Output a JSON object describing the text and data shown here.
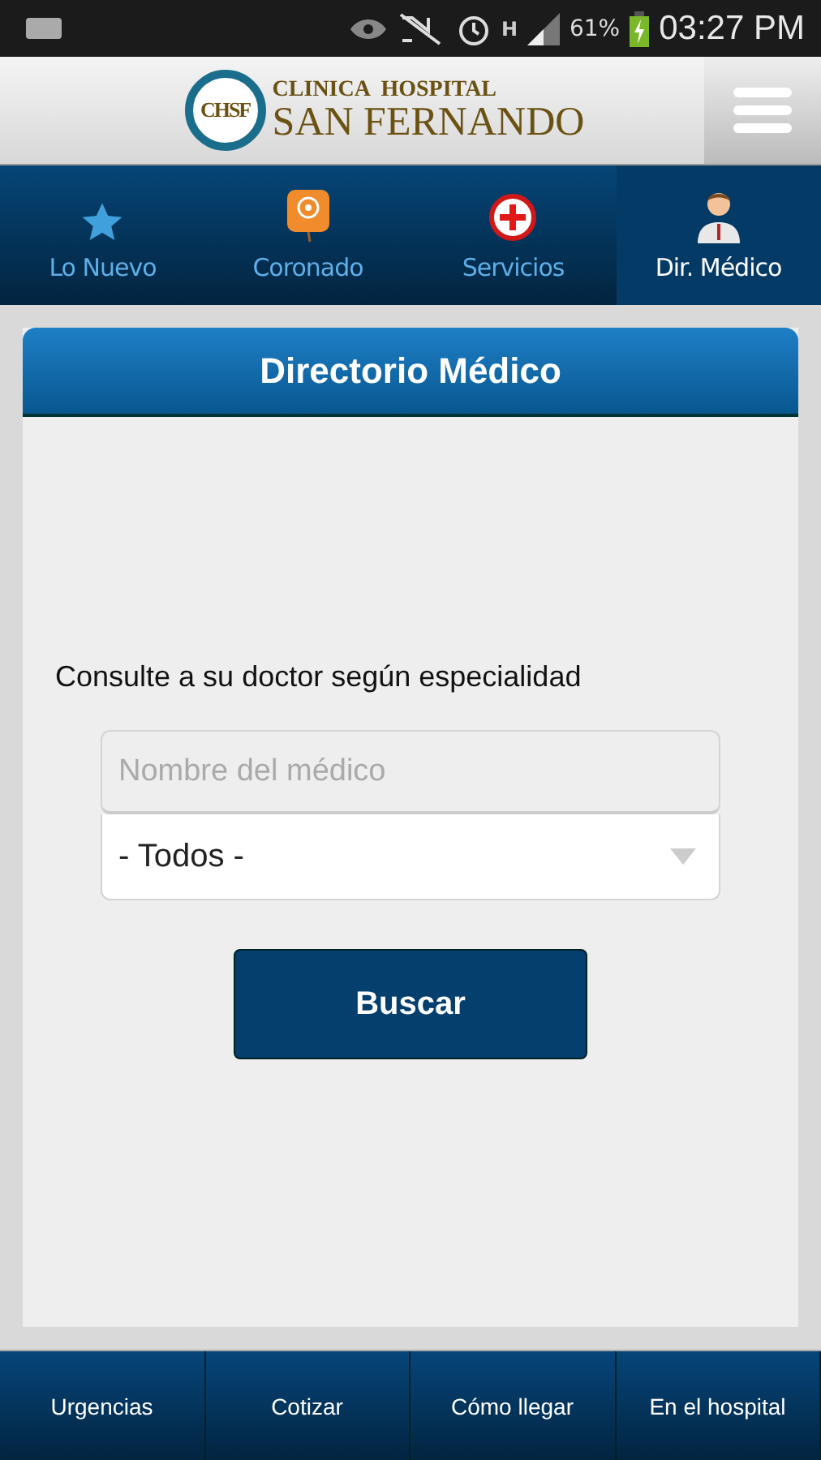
{
  "status_bar": {
    "network": "H",
    "battery": "61%",
    "time": "03:27 PM"
  },
  "header": {
    "logo_mark": "CHSF",
    "logo_top": "CLINICA  HOSPITAL",
    "logo_bottom": "SAN FERNANDO"
  },
  "tabs": [
    {
      "label": "Lo Nuevo",
      "selected": false
    },
    {
      "label": "Coronado",
      "selected": false
    },
    {
      "label": "Servicios",
      "selected": false
    },
    {
      "label": "Dir. Médico",
      "selected": true
    }
  ],
  "card": {
    "title": "Directorio Médico",
    "prompt": "Consulte a su doctor según especialidad",
    "name_field": {
      "placeholder": "Nombre del médico"
    },
    "specialty_select": {
      "value": "- Todos -"
    },
    "button": "Buscar"
  },
  "footer": [
    "Urgencias",
    "Cotizar",
    "Cómo llegar",
    "En el hospital"
  ]
}
